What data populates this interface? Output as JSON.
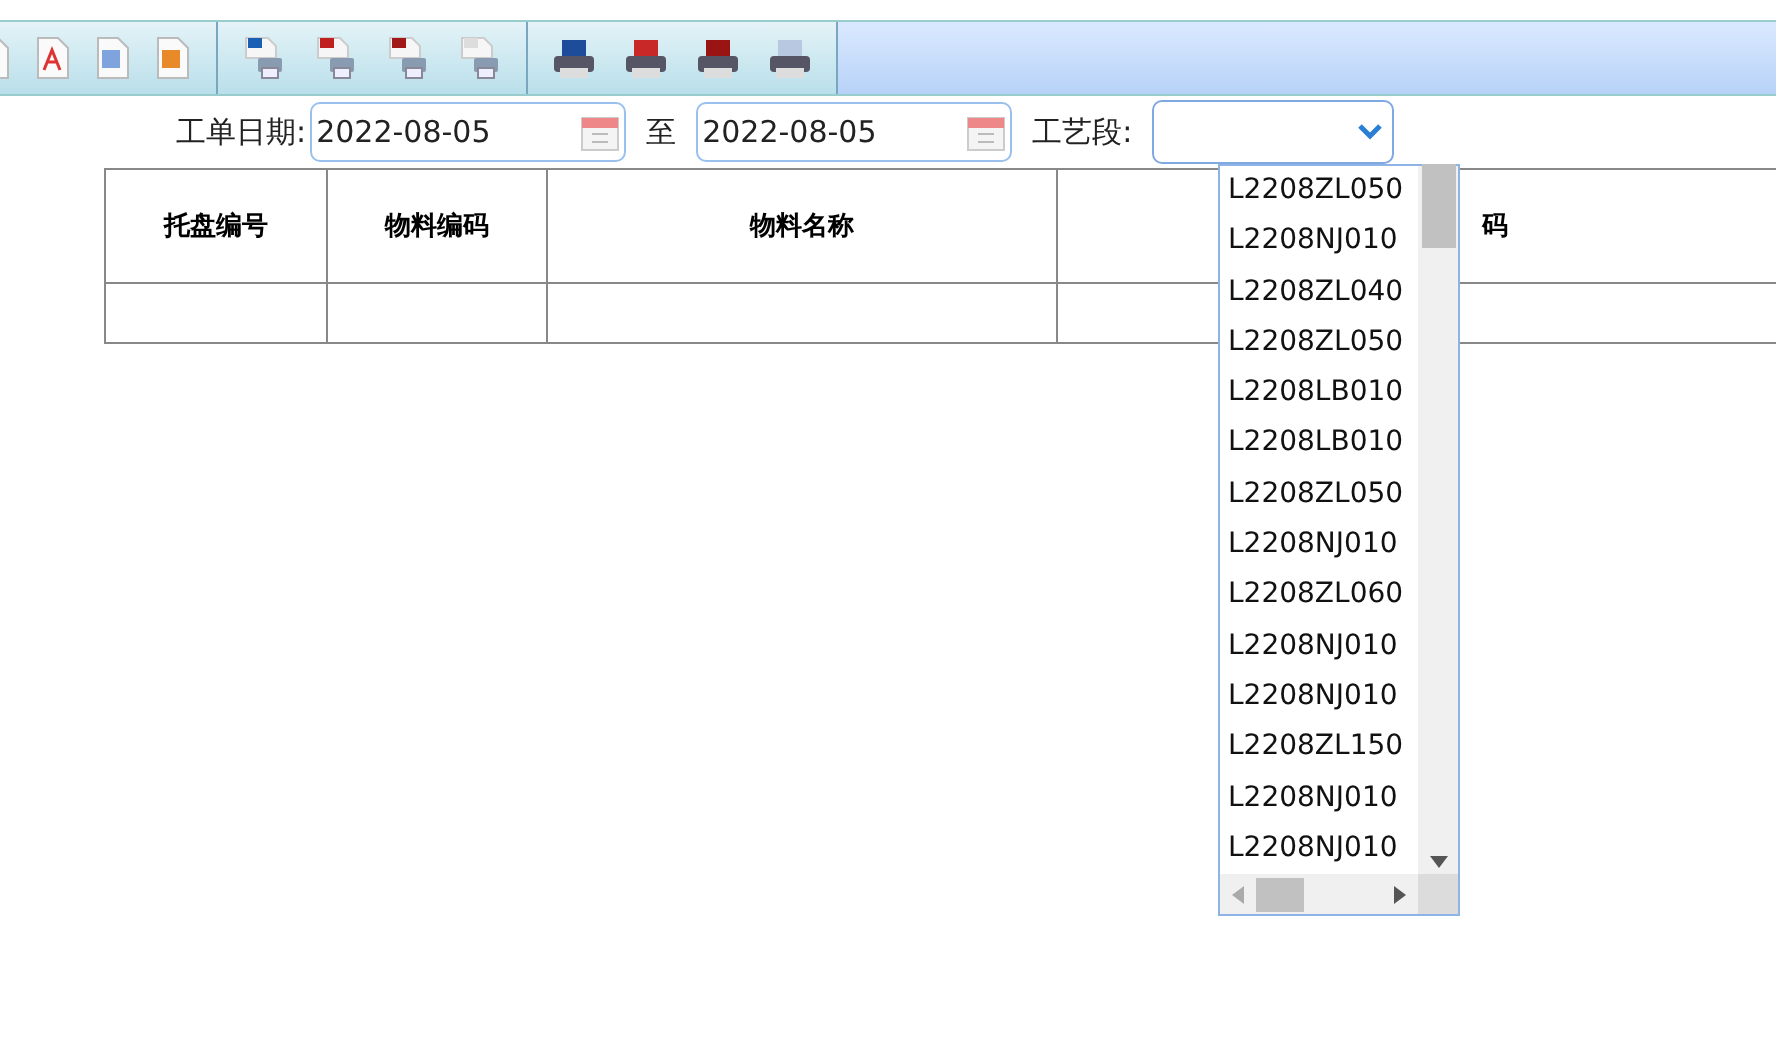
{
  "filter": {
    "date_label": "工单日期:",
    "date_from": "2022-08-05",
    "to_label": "至",
    "date_to": "2022-08-05",
    "stage_label": "工艺段:"
  },
  "table": {
    "columns": [
      "托盘编号",
      "物料编码",
      "物料名称",
      "码"
    ]
  },
  "dropdown": {
    "options": [
      "L2208ZL050",
      "L2208NJ010",
      "L2208ZL040",
      "L2208ZL050",
      "L2208LB010",
      "L2208LB010",
      "L2208ZL050",
      "L2208NJ010",
      "L2208ZL060",
      "L2208NJ010",
      "L2208NJ010",
      "L2208ZL150",
      "L2208NJ010",
      "L2208NJ010"
    ]
  }
}
